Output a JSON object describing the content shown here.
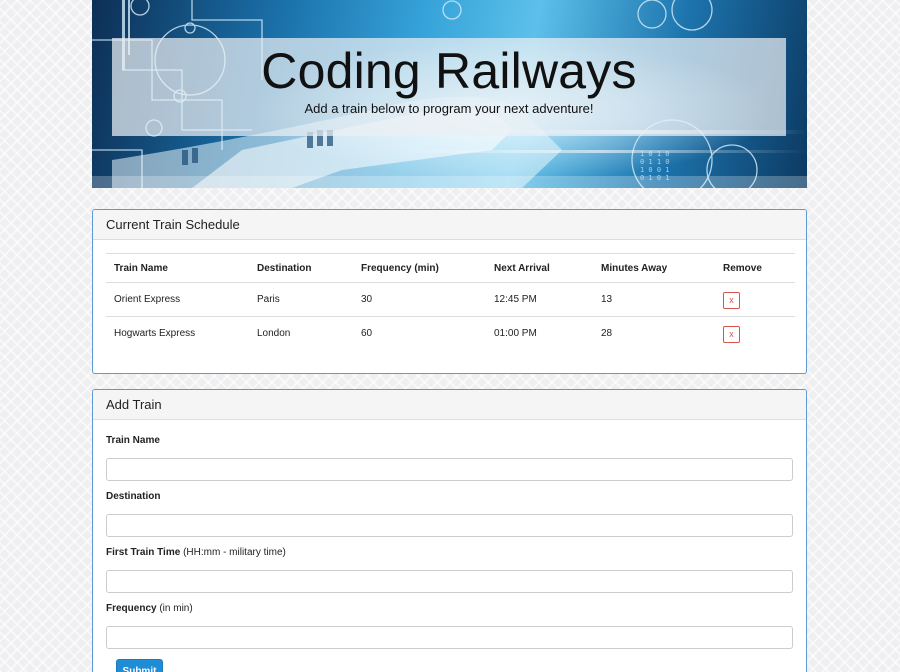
{
  "hero": {
    "title": "Coding Railways",
    "subtitle": "Add a train below to program your next adventure!"
  },
  "schedule": {
    "heading": "Current Train Schedule",
    "columns": [
      "Train Name",
      "Destination",
      "Frequency (min)",
      "Next Arrival",
      "Minutes Away",
      "Remove"
    ],
    "rows": [
      {
        "name": "Orient Express",
        "destination": "Paris",
        "frequency": "30",
        "next_arrival": "12:45 PM",
        "minutes_away": "13",
        "remove": "x"
      },
      {
        "name": "Hogwarts Express",
        "destination": "London",
        "frequency": "60",
        "next_arrival": "01:00 PM",
        "minutes_away": "28",
        "remove": "x"
      }
    ]
  },
  "add_train": {
    "heading": "Add Train",
    "fields": [
      {
        "label": "Train Name",
        "hint": "",
        "value": ""
      },
      {
        "label": "Destination",
        "hint": "",
        "value": ""
      },
      {
        "label": "First Train Time",
        "hint": " (HH:mm - military time)",
        "value": ""
      },
      {
        "label": "Frequency",
        "hint": " (in min)",
        "value": ""
      }
    ],
    "submit_label": "Submit"
  },
  "colors": {
    "panel_border": "#5b9bd5",
    "submit_bg": "#1f8dd6",
    "remove_red": "#d9534f"
  }
}
